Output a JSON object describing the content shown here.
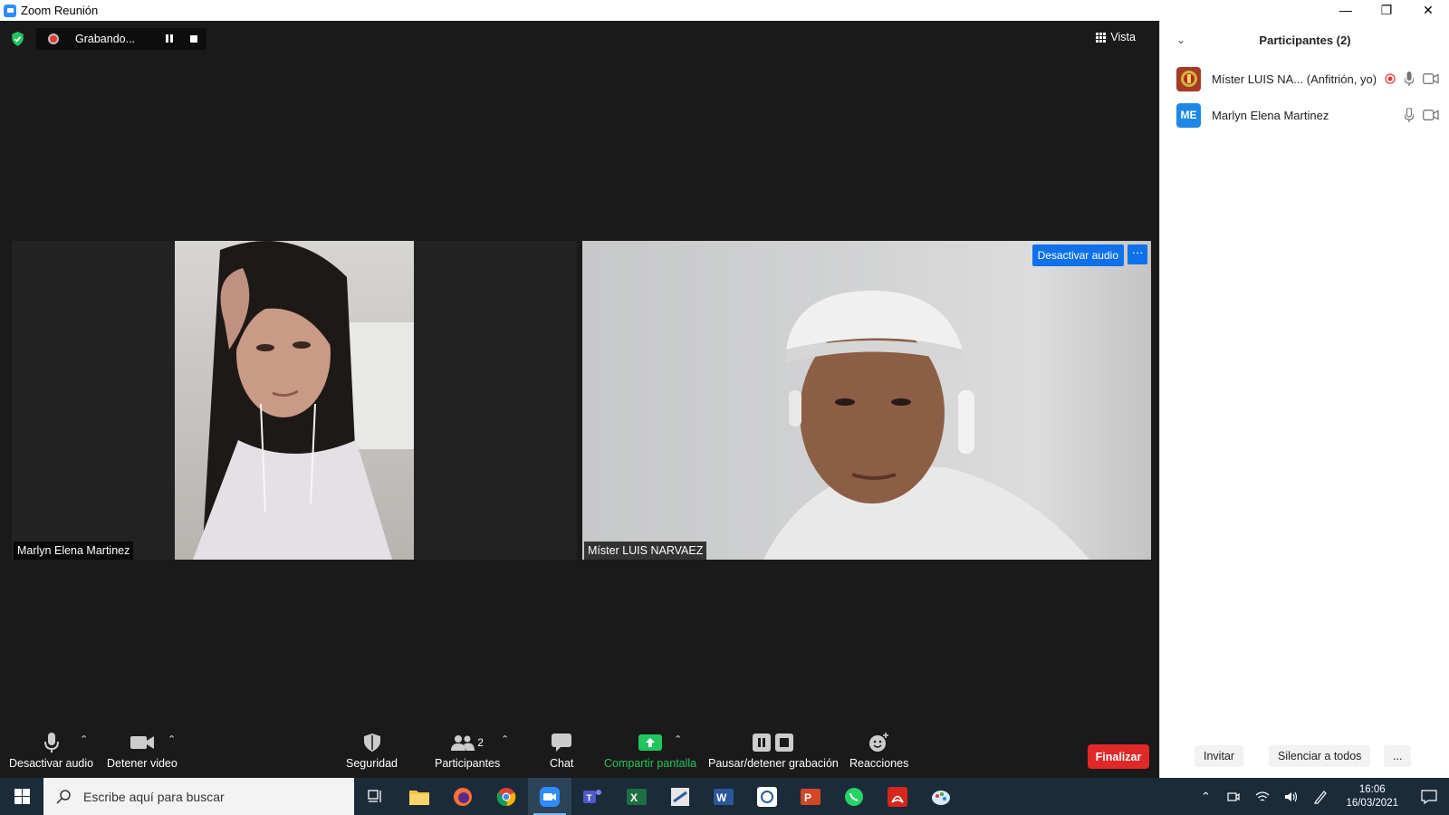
{
  "window": {
    "title": "Zoom Reunión"
  },
  "meeting": {
    "recording_status": "Grabando...",
    "view_label": "Vista"
  },
  "tiles": [
    {
      "name": "Marlyn Elena Martinez"
    },
    {
      "name": "Míster LUIS NARVAEZ",
      "hover_button": "Desactivar audio",
      "more_button": "···"
    }
  ],
  "toolbar": {
    "mute": "Desactivar audio",
    "video": "Detener video",
    "security": "Seguridad",
    "participants": "Participantes",
    "participants_count": "2",
    "chat": "Chat",
    "share": "Compartir pantalla",
    "record": "Pausar/detener grabación",
    "reactions": "Reacciones",
    "end": "Finalizar"
  },
  "panel": {
    "title": "Participantes (2)",
    "participants": [
      {
        "name": "Míster LUIS NA... (Anfitrión, yo)",
        "avatar": "",
        "avatar_color": "#a33b26"
      },
      {
        "name": "Marlyn Elena Martinez",
        "avatar": "ME",
        "avatar_color": "#1e88e5"
      }
    ],
    "invite": "Invitar",
    "mute_all": "Silenciar a todos",
    "more": "..."
  },
  "taskbar": {
    "search_placeholder": "Escribe aquí para buscar",
    "time": "16:06",
    "date": "16/03/2021",
    "apps": [
      "task-view-icon",
      "file-explorer-icon",
      "firefox-icon",
      "chrome-icon",
      "zoom-icon",
      "teams-icon",
      "excel-icon",
      "app-icon",
      "word-icon",
      "app-icon",
      "powerpoint-icon",
      "whatsapp-icon",
      "acrobat-icon",
      "paint-icon"
    ]
  },
  "colors": {
    "accent": "#0e71eb",
    "end_red": "#e02828",
    "share_green": "#22c55e",
    "taskbar": "#1b2b3a"
  }
}
